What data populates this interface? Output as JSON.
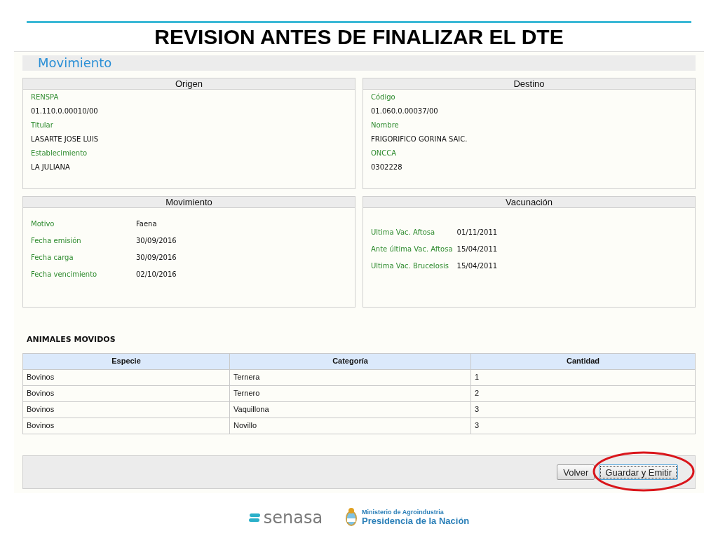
{
  "slide_title": "REVISION ANTES DE FINALIZAR EL DTE",
  "section_title": "Movimiento",
  "panels": [
    {
      "title": "Origen",
      "kind": "stacked",
      "fields": [
        {
          "label": "RENSPA",
          "value": "01.110.0.00010/00"
        },
        {
          "label": "Titular",
          "value": "LASARTE JOSE LUIS"
        },
        {
          "label": "Establecimiento",
          "value": "LA JULIANA"
        }
      ]
    },
    {
      "title": "Destino",
      "kind": "stacked",
      "fields": [
        {
          "label": "Código",
          "value": "01.060.0.00037/00"
        },
        {
          "label": "Nombre",
          "value": "FRIGORIFICO GORINA SAIC."
        },
        {
          "label": "ONCCA",
          "value": "0302228"
        }
      ]
    },
    {
      "title": "Movimiento",
      "kind": "pairs",
      "fields": [
        {
          "label": "Motivo",
          "value": "Faena"
        },
        {
          "label": "Fecha emisión",
          "value": "30/09/2016"
        },
        {
          "label": "Fecha carga",
          "value": "30/09/2016"
        },
        {
          "label": "Fecha vencimiento",
          "value": "02/10/2016"
        }
      ]
    },
    {
      "title": "Vacunación",
      "kind": "pairs",
      "fields": [
        {
          "label": "Ultima Vac. Aftosa",
          "value": "01/11/2011"
        },
        {
          "label": "Ante última Vac. Aftosa",
          "value": "15/04/2011"
        },
        {
          "label": "Ultima Vac. Brucelosis",
          "value": "15/04/2011"
        }
      ]
    }
  ],
  "animals": {
    "title": "ANIMALES MOVIDOS",
    "columns": [
      "Especie",
      "Categoría",
      "Cantidad"
    ],
    "rows": [
      [
        "Bovinos",
        "Ternera",
        "1"
      ],
      [
        "Bovinos",
        "Ternero",
        "2"
      ],
      [
        "Bovinos",
        "Vaquillona",
        "3"
      ],
      [
        "Bovinos",
        "Novillo",
        "3"
      ]
    ]
  },
  "buttons": [
    {
      "label": "Volver",
      "focused": false,
      "circled": false
    },
    {
      "label": "Guardar y Emitir",
      "focused": true,
      "circled": true
    }
  ],
  "footer": {
    "brand": "senasa",
    "ministry": "Ministerio de Agroindustria",
    "presidency": "Presidencia de la Nación"
  }
}
